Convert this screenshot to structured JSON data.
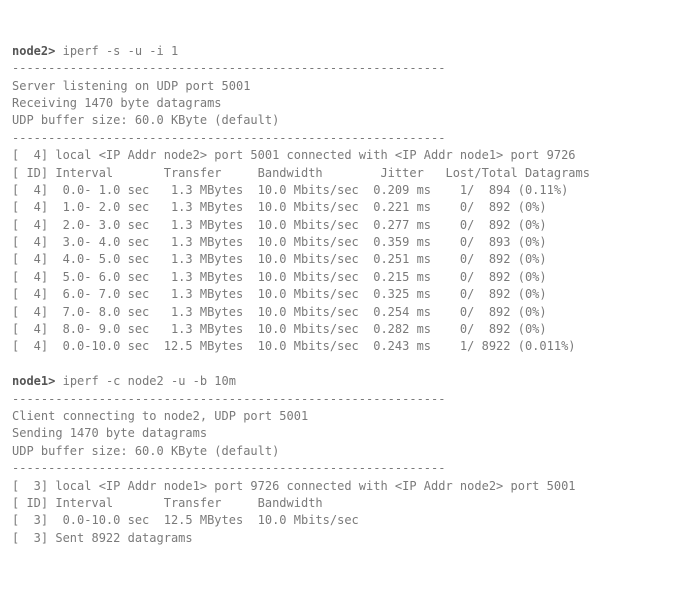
{
  "server": {
    "prompt_host": "node2>",
    "command": "iperf -s -u -i 1",
    "dashes_short": "------------------------------------------------------------",
    "listening": "Server listening on UDP port 5001",
    "receiving": "Receiving 1470 byte datagrams",
    "buffer": "UDP buffer size: 60.0 KByte (default)",
    "conn_line": "[  4] local <IP Addr node2> port 5001 connected with <IP Addr node1> port 9726",
    "header": "[ ID] Interval       Transfer     Bandwidth        Jitter   Lost/Total Datagrams",
    "rows": [
      "[  4]  0.0- 1.0 sec   1.3 MBytes  10.0 Mbits/sec  0.209 ms    1/  894 (0.11%)",
      "[  4]  1.0- 2.0 sec   1.3 MBytes  10.0 Mbits/sec  0.221 ms    0/  892 (0%)",
      "[  4]  2.0- 3.0 sec   1.3 MBytes  10.0 Mbits/sec  0.277 ms    0/  892 (0%)",
      "[  4]  3.0- 4.0 sec   1.3 MBytes  10.0 Mbits/sec  0.359 ms    0/  893 (0%)",
      "[  4]  4.0- 5.0 sec   1.3 MBytes  10.0 Mbits/sec  0.251 ms    0/  892 (0%)",
      "[  4]  5.0- 6.0 sec   1.3 MBytes  10.0 Mbits/sec  0.215 ms    0/  892 (0%)",
      "[  4]  6.0- 7.0 sec   1.3 MBytes  10.0 Mbits/sec  0.325 ms    0/  892 (0%)",
      "[  4]  7.0- 8.0 sec   1.3 MBytes  10.0 Mbits/sec  0.254 ms    0/  892 (0%)",
      "[  4]  8.0- 9.0 sec   1.3 MBytes  10.0 Mbits/sec  0.282 ms    0/  892 (0%)",
      "[  4]  0.0-10.0 sec  12.5 MBytes  10.0 Mbits/sec  0.243 ms    1/ 8922 (0.011%)"
    ]
  },
  "client": {
    "prompt_host": "node1>",
    "command": "iperf -c node2 -u -b 10m",
    "dashes_short": "------------------------------------------------------------",
    "connecting": "Client connecting to node2, UDP port 5001",
    "sending": "Sending 1470 byte datagrams",
    "buffer": "UDP buffer size: 60.0 KByte (default)",
    "conn_line": "[  3] local <IP Addr node1> port 9726 connected with <IP Addr node2> port 5001",
    "header": "[ ID] Interval       Transfer     Bandwidth",
    "rows": [
      "[  3]  0.0-10.0 sec  12.5 MBytes  10.0 Mbits/sec",
      "[  3] Sent 8922 datagrams"
    ]
  },
  "chart_data": {
    "type": "table",
    "title": "iperf UDP server interval report (node2)",
    "columns": [
      "ID",
      "Interval (sec)",
      "Transfer (MBytes)",
      "Bandwidth (Mbits/sec)",
      "Jitter (ms)",
      "Lost",
      "Total",
      "Lost %"
    ],
    "rows": [
      [
        4,
        "0.0-1.0",
        1.3,
        10.0,
        0.209,
        1,
        894,
        0.11
      ],
      [
        4,
        "1.0-2.0",
        1.3,
        10.0,
        0.221,
        0,
        892,
        0
      ],
      [
        4,
        "2.0-3.0",
        1.3,
        10.0,
        0.277,
        0,
        892,
        0
      ],
      [
        4,
        "3.0-4.0",
        1.3,
        10.0,
        0.359,
        0,
        893,
        0
      ],
      [
        4,
        "4.0-5.0",
        1.3,
        10.0,
        0.251,
        0,
        892,
        0
      ],
      [
        4,
        "5.0-6.0",
        1.3,
        10.0,
        0.215,
        0,
        892,
        0
      ],
      [
        4,
        "6.0-7.0",
        1.3,
        10.0,
        0.325,
        0,
        892,
        0
      ],
      [
        4,
        "7.0-8.0",
        1.3,
        10.0,
        0.254,
        0,
        892,
        0
      ],
      [
        4,
        "8.0-9.0",
        1.3,
        10.0,
        0.282,
        0,
        892,
        0
      ],
      [
        4,
        "0.0-10.0",
        12.5,
        10.0,
        0.243,
        1,
        8922,
        0.011
      ]
    ],
    "client_summary": {
      "id": 3,
      "interval_sec": "0.0-10.0",
      "transfer_mbytes": 12.5,
      "bandwidth_mbits_sec": 10.0,
      "sent_datagrams": 8922
    }
  }
}
